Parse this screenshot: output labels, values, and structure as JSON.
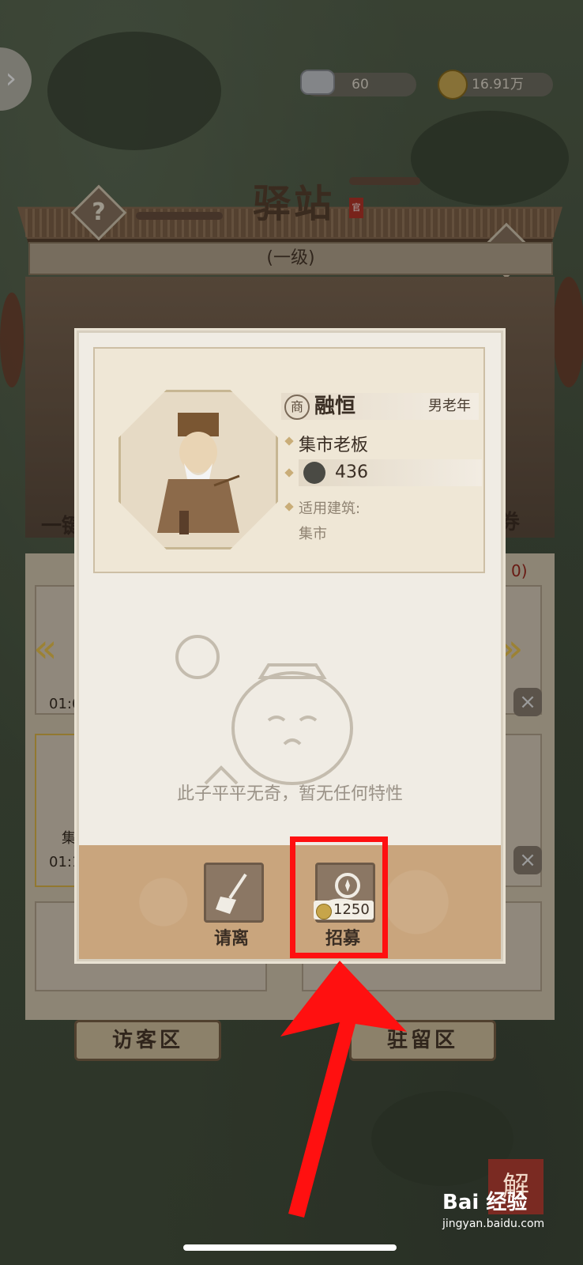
{
  "resources": {
    "silver_value": "60",
    "copper_value": "16.91万"
  },
  "station": {
    "title": "驿站",
    "level": "(一级)",
    "stamp": "官"
  },
  "background_list": {
    "left_edge_char": "一键",
    "right_edge_char": "券",
    "row_labels": [
      "01:0",
      "01:1",
      "集市"
    ],
    "count_suffix": "0)"
  },
  "tabs": {
    "visitor_area": "访客区",
    "stay_area": "驻留区"
  },
  "character": {
    "name_icon_char": "商",
    "name": "融恒",
    "gender_age": "男老年",
    "occupation": "集市老板",
    "stat_value": "436",
    "building_label": "适用建筑:",
    "building_value": "集市",
    "trait_text": "此子平平无奇，暂无任何特性"
  },
  "actions": {
    "dismiss_label": "请离",
    "recruit_label": "招募",
    "recruit_cost": "1250"
  },
  "watermark": {
    "brand": "Bai 经验",
    "url": "jingyan.baidu.com",
    "stamp_char": "解"
  },
  "colors": {
    "highlight": "#ff1010",
    "accent_gold": "#f0c850",
    "panel_bg": "#f0ece4"
  }
}
